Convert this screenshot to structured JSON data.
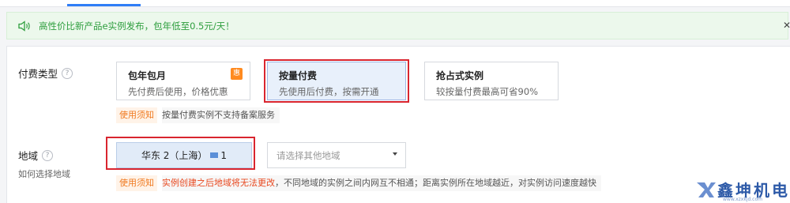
{
  "notice": {
    "text": "高性价比新产品e实例发布，包年低至0.5元/天！"
  },
  "billing": {
    "label": "付费类型",
    "help": "?",
    "options": [
      {
        "title": "包年包月",
        "desc": "先付费后使用，价格优惠",
        "badge": "惠",
        "selected": false
      },
      {
        "title": "按量付费",
        "desc": "先使用后付费，按需开通",
        "selected": true
      },
      {
        "title": "抢占式实例",
        "desc": "较按量付费最高可省90%",
        "selected": false
      }
    ],
    "tip_tag": "使用须知",
    "tip_text": "按量付费实例不支持备案服务"
  },
  "region": {
    "label": "地域",
    "help": "?",
    "sub_link": "如何选择地域",
    "selected_region": "华东 2（上海）",
    "selected_count": "1",
    "select_placeholder": "请选择其他地域",
    "tip_tag": "使用须知",
    "tip_red": "实例创建之后地域将无法更改",
    "tip_text": "，不同地域的实例之间内网互不相通；距离实例所在地域越近，对实例访问速度越快"
  },
  "watermark": {
    "brand": "鑫坤机电",
    "site": "www.xzxkjd.com"
  },
  "colors": {
    "accent": "#2f7df6",
    "highlight": "#d9252f",
    "notice_green": "#2e9e3e",
    "tip_orange": "#f07a20"
  }
}
